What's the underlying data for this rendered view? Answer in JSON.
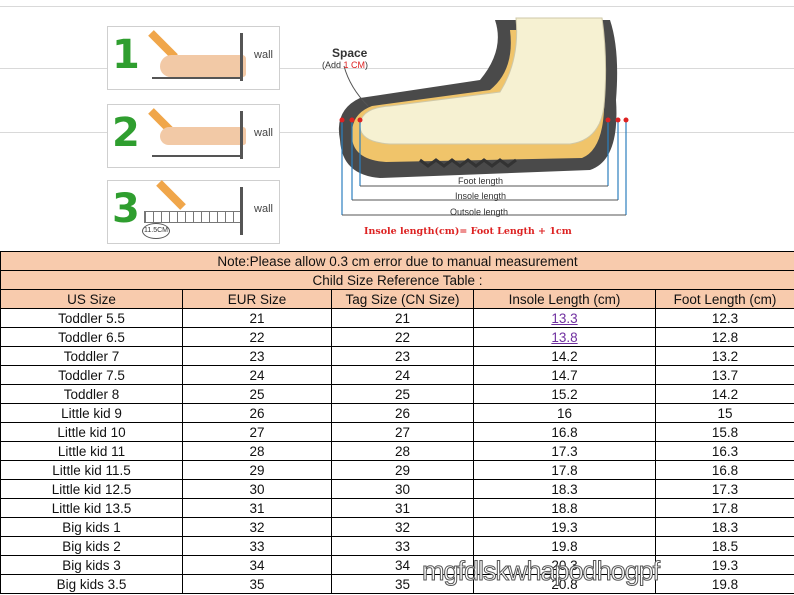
{
  "instructions": {
    "steps": [
      {
        "number": "1",
        "wall_label": "wall"
      },
      {
        "number": "2",
        "wall_label": "wall"
      },
      {
        "number": "3",
        "wall_label": "wall",
        "ruler_mark": "11.5CM"
      }
    ]
  },
  "diagram": {
    "space_label": "Space",
    "space_sub_prefix": "(Add ",
    "space_sub_value": "1 CM",
    "space_sub_suffix": ")",
    "foot_length_label": "Foot length",
    "insole_length_label": "Insole length",
    "outsole_length_label": "Outsole length",
    "formula": "Insole length(cm)= Foot Length + 1cm"
  },
  "table": {
    "note": "Note:Please allow 0.3 cm error due to manual measurement",
    "title": "Child Size Reference Table :",
    "headers": [
      "US Size",
      "EUR Size",
      "Tag Size (CN Size)",
      "Insole Length (cm)",
      "Foot Length (cm)"
    ],
    "rows": [
      [
        "Toddler 5.5",
        "21",
        "21",
        "13.3",
        "12.3"
      ],
      [
        "Toddler 6.5",
        "22",
        "22",
        "13.8",
        "12.8"
      ],
      [
        "Toddler 7",
        "23",
        "23",
        "14.2",
        "13.2"
      ],
      [
        "Toddler 7.5",
        "24",
        "24",
        "14.7",
        "13.7"
      ],
      [
        "Toddler 8",
        "25",
        "25",
        "15.2",
        "14.2"
      ],
      [
        "Little kid 9",
        "26",
        "26",
        "16",
        "15"
      ],
      [
        "Little kid 10",
        "27",
        "27",
        "16.8",
        "15.8"
      ],
      [
        "Little kid 11",
        "28",
        "28",
        "17.3",
        "16.3"
      ],
      [
        "Little kid 11.5",
        "29",
        "29",
        "17.8",
        "16.8"
      ],
      [
        "Little kid 12.5",
        "30",
        "30",
        "18.3",
        "17.3"
      ],
      [
        "Little kid 13.5",
        "31",
        "31",
        "18.8",
        "17.8"
      ],
      [
        "Big kids 1",
        "32",
        "32",
        "19.3",
        "18.3"
      ],
      [
        "Big kids 2",
        "33",
        "33",
        "19.8",
        "18.5"
      ],
      [
        "Big kids 3",
        "34",
        "34",
        "20.3",
        "19.3"
      ],
      [
        "Big kids 3.5",
        "35",
        "35",
        "20.8",
        "19.8"
      ]
    ]
  },
  "watermark": "mgfdlskwhapodhogpf",
  "colors": {
    "band": "#f8cbad",
    "accent_red": "#d22222",
    "step_green": "#2f9e2f",
    "link_purple": "#7030a0"
  }
}
